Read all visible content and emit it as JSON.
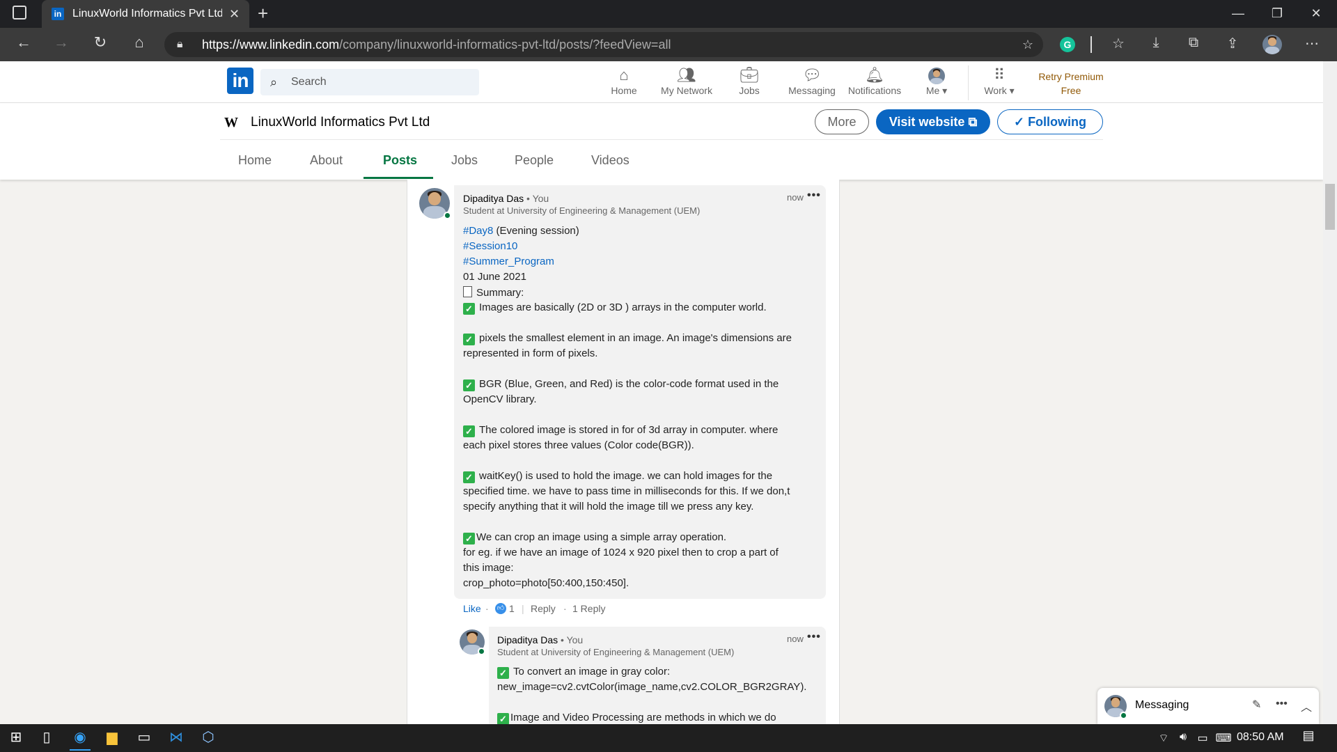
{
  "browser": {
    "tab_title": "LinuxWorld Informatics Pvt Ltd: P",
    "url_host": "https://www.linkedin.com",
    "url_path": "/company/linuxworld-informatics-pvt-ltd/posts/?feedView=all"
  },
  "linkedin": {
    "logo_text": "in",
    "search_placeholder": "Search",
    "nav": [
      {
        "label": "Home",
        "icon": "home-icon"
      },
      {
        "label": "My Network",
        "icon": "network-icon"
      },
      {
        "label": "Jobs",
        "icon": "briefcase-icon"
      },
      {
        "label": "Messaging",
        "icon": "chat-icon"
      },
      {
        "label": "Notifications",
        "icon": "bell-icon"
      },
      {
        "label": "Me",
        "icon": "avatar"
      },
      {
        "label": "Work",
        "icon": "grid-icon"
      }
    ],
    "premium_line1": "Retry Premium",
    "premium_line2": "Free"
  },
  "company": {
    "name": "LinuxWorld Informatics Pvt Ltd",
    "more_label": "More",
    "visit_label": "Visit website",
    "follow_label": "Following",
    "tabs": [
      "Home",
      "About",
      "Posts",
      "Jobs",
      "People",
      "Videos"
    ],
    "active_tab": "Posts"
  },
  "comment": {
    "author": "Dipaditya Das",
    "you": "• You",
    "headline": "Student at University of Engineering & Management (UEM)",
    "time": "now",
    "lines": {
      "l1_tag": "#Day8",
      "l1_rest": " (Evening session)",
      "l2": "#Session10",
      "l3": "#Summer_Program",
      "l4": "01 June 2021",
      "l5": "Summary:",
      "l6": "Images are basically (2D or 3D ) arrays in the computer world.",
      "l7": "pixels the smallest element in an image. An image's dimensions are",
      "l8": "represented in form of pixels.",
      "l9": "BGR (Blue, Green, and Red) is the color-code format used in the",
      "l10": "OpenCV library.",
      "l11": "The colored image is stored in for of 3d array in computer. where",
      "l12": "each pixel stores three values (Color code(BGR)).",
      "l13": "waitKey() is used to hold the image. we can hold images for the",
      "l14": "specified time. we have to pass time in milliseconds for this. If we don,t",
      "l15": "specify anything that it will hold the image till we press any key.",
      "l16": "We can crop an image using a simple array operation.",
      "l17": "for eg. if we have an image of 1024 x 920 pixel then to crop a part of",
      "l18": "this image:",
      "l19": "crop_photo=photo[50:400,150:450]."
    },
    "like_label": "Like",
    "like_count": "1",
    "reply_label": "Reply",
    "replies_label": "1 Reply"
  },
  "reply": {
    "author": "Dipaditya Das",
    "you": "• You",
    "headline": "Student at University of Engineering & Management (UEM)",
    "time": "now",
    "r1": "To convert an image in gray color:",
    "r2": "new_image=cv2.cvtColor(image_name,cv2.COLOR_BGR2GRAY).",
    "r3": "Image and Video Processing are methods in which we do"
  },
  "messaging": {
    "label": "Messaging"
  },
  "taskbar": {
    "time": "08:50 AM"
  }
}
